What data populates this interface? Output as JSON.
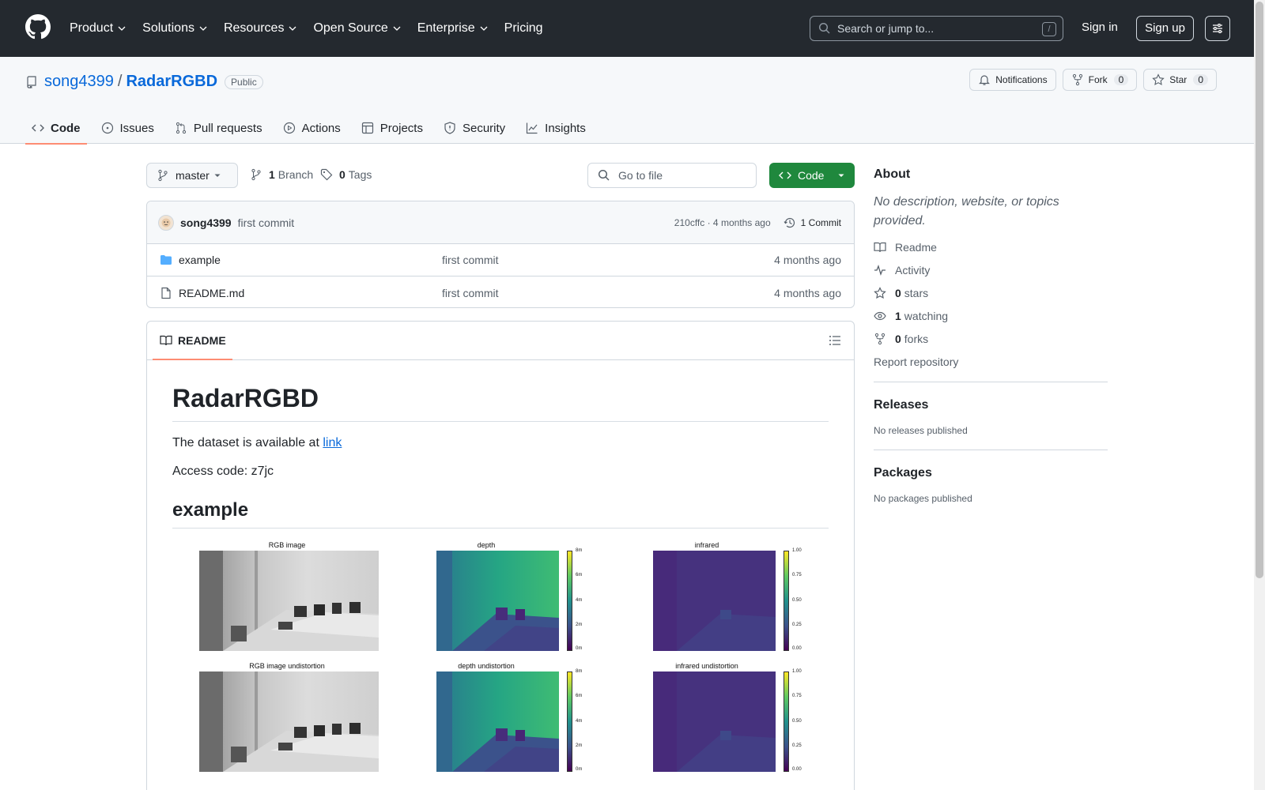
{
  "header": {
    "nav": [
      {
        "label": "Product",
        "dropdown": true
      },
      {
        "label": "Solutions",
        "dropdown": true
      },
      {
        "label": "Resources",
        "dropdown": true
      },
      {
        "label": "Open Source",
        "dropdown": true
      },
      {
        "label": "Enterprise",
        "dropdown": true
      },
      {
        "label": "Pricing",
        "dropdown": false
      }
    ],
    "search_placeholder": "Search or jump to...",
    "search_shortcut": "/",
    "signin": "Sign in",
    "signup": "Sign up"
  },
  "repo": {
    "owner": "song4399",
    "separator": "/",
    "name": "RadarRGBD",
    "visibility": "Public",
    "notifications": "Notifications",
    "fork_label": "Fork",
    "fork_count": "0",
    "star_label": "Star",
    "star_count": "0",
    "tabs": [
      {
        "label": "Code",
        "icon": "code-icon",
        "active": true
      },
      {
        "label": "Issues",
        "icon": "issue-icon",
        "active": false
      },
      {
        "label": "Pull requests",
        "icon": "pull-request-icon",
        "active": false
      },
      {
        "label": "Actions",
        "icon": "play-icon",
        "active": false
      },
      {
        "label": "Projects",
        "icon": "table-icon",
        "active": false
      },
      {
        "label": "Security",
        "icon": "shield-icon",
        "active": false
      },
      {
        "label": "Insights",
        "icon": "graph-icon",
        "active": false
      }
    ]
  },
  "branchbar": {
    "branch": "master",
    "branch_count": "1",
    "branch_label": "Branch",
    "tag_count": "0",
    "tag_label": "Tags",
    "gofile_placeholder": "Go to file",
    "code_button": "Code"
  },
  "commit": {
    "author": "song4399",
    "message": "first commit",
    "sha_time": "210cffc · 4 months ago",
    "commits_label": "1 Commit"
  },
  "files": [
    {
      "name": "example",
      "type": "folder",
      "message": "first commit",
      "date": "4 months ago"
    },
    {
      "name": "README.md",
      "type": "file",
      "message": "first commit",
      "date": "4 months ago"
    }
  ],
  "readme": {
    "tab": "README",
    "h1": "RadarRGBD",
    "p1_text": "The dataset is available at ",
    "p1_link": "link",
    "p2": "Access code: z7jc",
    "h2": "example",
    "figures": {
      "rgb": "RGB image",
      "depth": "depth",
      "infrared": "infrared",
      "rgb_u": "RGB image undistortion",
      "depth_u": "depth undistortion",
      "infrared_u": "infrared undistortion",
      "depth_ticks": [
        "8m",
        "6m",
        "4m",
        "2m",
        "0m"
      ],
      "ir_ticks": [
        "1.00",
        "0.75",
        "0.50",
        "0.25",
        "0.00"
      ]
    }
  },
  "sidebar": {
    "about": "About",
    "description": "No description, website, or topics provided.",
    "readme": "Readme",
    "activity": "Activity",
    "stars_count": "0",
    "stars_label": "stars",
    "watching_count": "1",
    "watching_label": "watching",
    "forks_count": "0",
    "forks_label": "forks",
    "report": "Report repository",
    "releases": "Releases",
    "no_releases": "No releases published",
    "packages": "Packages",
    "no_packages": "No packages published"
  },
  "colors": {
    "header_bg": "#24292f",
    "link": "#0969da",
    "code_button": "#1f883d",
    "active_tab_underline": "#fd8c73",
    "folder": "#54aeff"
  }
}
